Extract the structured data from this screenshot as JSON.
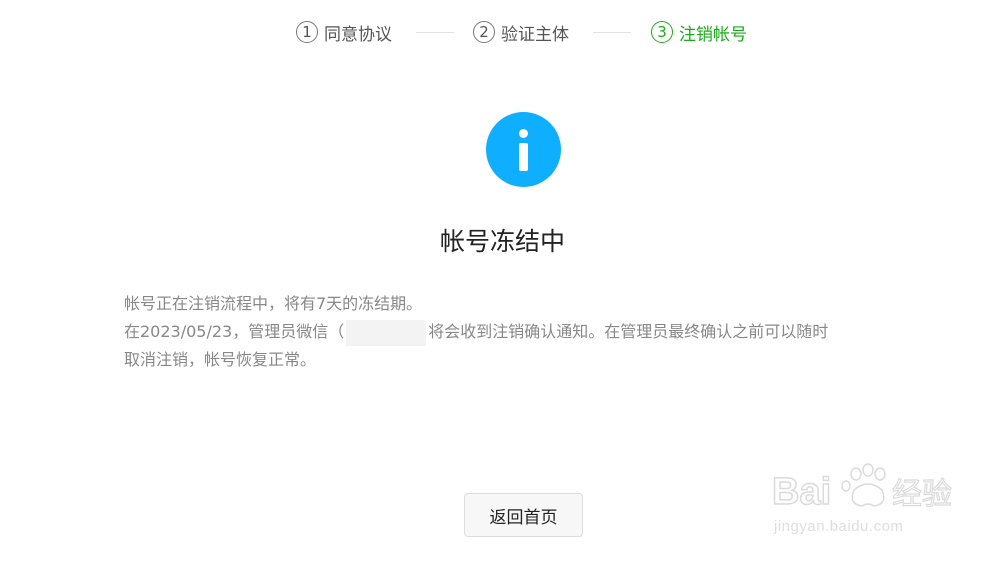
{
  "steps": [
    {
      "number": "1",
      "label": "同意协议",
      "active": false
    },
    {
      "number": "2",
      "label": "验证主体",
      "active": false
    },
    {
      "number": "3",
      "label": "注销帐号",
      "active": true
    }
  ],
  "status": {
    "icon": "info-icon",
    "title": "帐号冻结中"
  },
  "description": {
    "line1": "帐号正在注销流程中，将有7天的冻结期。",
    "line2_prefix": "在2023/05/23，管理员微信（",
    "line2_suffix": "将会收到注销确认通知。在管理员最终确认之前可以随时",
    "line3": "取消注销，帐号恢复正常。"
  },
  "actions": {
    "back_label": "返回首页"
  },
  "watermark": {
    "brand": "Bai 经验",
    "url": "jingyan.baidu.com"
  },
  "colors": {
    "accent_green": "#1aad19",
    "info_blue": "#10aeff"
  }
}
